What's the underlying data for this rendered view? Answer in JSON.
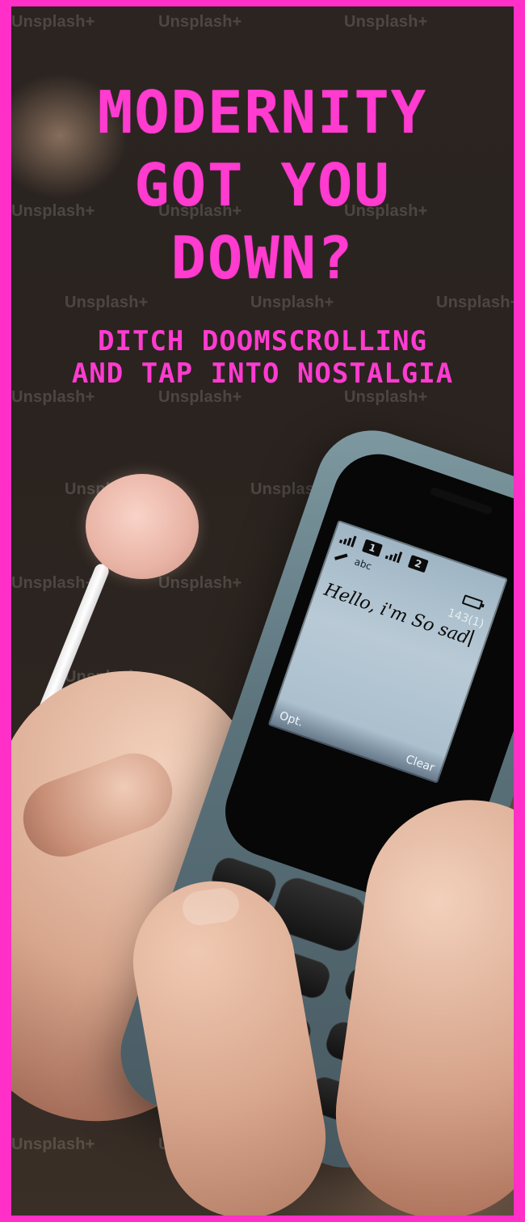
{
  "poster": {
    "headline_lines": [
      "MODERNITY",
      "GOT YOU",
      "DOWN?"
    ],
    "subheadline_lines": [
      "DITCH DOOMSCROLLING",
      "AND TAP INTO NOSTALGIA"
    ],
    "accent_color": "#ff2fc7"
  },
  "watermark": {
    "text": "Unsplash+"
  },
  "phone_screen": {
    "sim_1": "1",
    "sim_2": "2",
    "input_mode": "abc",
    "counter": "143(1)",
    "message_text": "Hello, i'm So sad",
    "left_softkey": "Opt.",
    "right_softkey": "Clear"
  }
}
